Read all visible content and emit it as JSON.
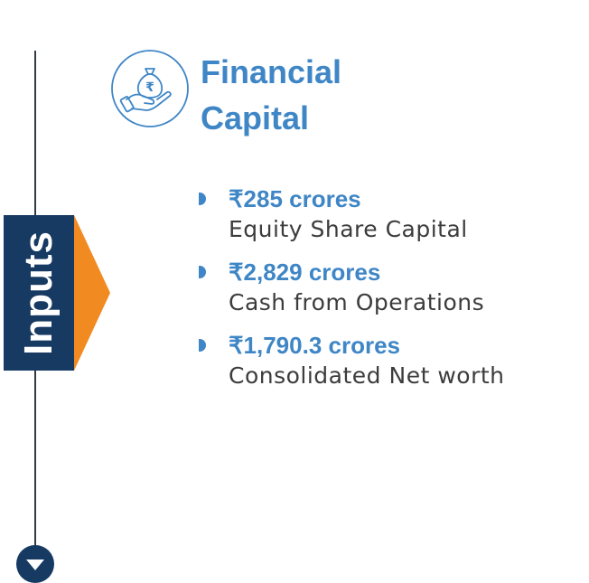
{
  "side_tab": {
    "label": "Inputs"
  },
  "section": {
    "title_line1": "Financial",
    "title_line2": "Capital",
    "icon": "hand-money-bag-rupee-icon"
  },
  "items": [
    {
      "value": "₹285 crores",
      "label": "Equity Share Capital"
    },
    {
      "value": "₹2,829 crores",
      "label": "Cash from Operations"
    },
    {
      "value": "₹1,790.3 crores",
      "label": "Consolidated Net worth"
    }
  ],
  "colors": {
    "navy": "#173a63",
    "orange": "#f28a22",
    "blue": "#3f86c6",
    "text": "#3c3c3c"
  }
}
